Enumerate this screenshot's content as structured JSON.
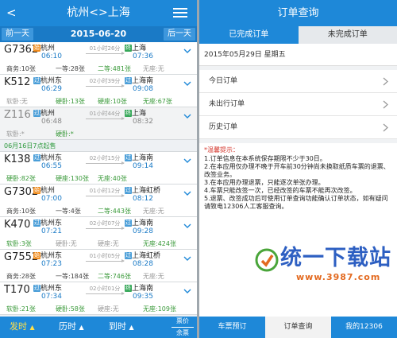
{
  "left": {
    "header": {
      "back": "<",
      "title": "杭州<>上海"
    },
    "datebar": {
      "prev": "前一天",
      "date": "2015-06-20",
      "next": "后一天"
    },
    "trains": [
      {
        "no": "G7362",
        "from_badge": "始",
        "from": "杭州",
        "dep": "06:10",
        "duration": "01小时26分",
        "to_badge": "终",
        "to": "上海",
        "arr": "07:36",
        "seats": [
          "商务:10张",
          "一等:28张",
          "二等:481张",
          "无座:无"
        ],
        "gray": false
      },
      {
        "no": "K512",
        "from_badge": "过",
        "from": "杭州东",
        "dep": "06:29",
        "duration": "02小时39分",
        "to_badge": "过",
        "to": "上海南",
        "arr": "09:08",
        "seats": [
          "软卧:无",
          "硬卧:13张",
          "硬座:10张",
          "无座:67张"
        ],
        "gray": false
      },
      {
        "no": "Z116",
        "from_badge": "过",
        "from": "杭州",
        "dep": "06:48",
        "duration": "01小时44分",
        "to_badge": "终",
        "to": "上海",
        "arr": "08:32",
        "seats": [
          "软卧:*",
          "硬卧:*"
        ],
        "gray": true
      },
      {
        "no": "K138",
        "from_badge": "过",
        "from": "杭州东",
        "dep": "06:55",
        "duration": "02小时15分",
        "to_badge": "过",
        "to": "上海南",
        "arr": "09:14",
        "seats": [
          "硬卧:82张",
          "硬座:130张",
          "无座:40张"
        ],
        "gray": false
      },
      {
        "no": "G7302",
        "from_badge": "始",
        "from": "杭州",
        "dep": "07:00",
        "duration": "01小时12分",
        "to_badge": "过",
        "to": "上海虹桥",
        "arr": "08:12",
        "seats": [
          "商务:10张",
          "一等:4张",
          "二等:443张",
          "无座:无"
        ],
        "gray": false
      },
      {
        "no": "K470",
        "from_badge": "过",
        "from": "杭州东",
        "dep": "07:21",
        "duration": "02小时07分",
        "to_badge": "过",
        "to": "上海南",
        "arr": "09:28",
        "seats": [
          "软卧:3张",
          "硬卧:无",
          "硬座:无",
          "无座:424张"
        ],
        "gray": false
      },
      {
        "no": "G7552",
        "from_badge": "始",
        "from": "杭州东",
        "dep": "07:23",
        "duration": "01小时05分",
        "to_badge": "过",
        "to": "上海虹桥",
        "arr": "08:28",
        "seats": [
          "商务:28张",
          "一等:184张",
          "二等:746张",
          "无座:无"
        ],
        "gray": false
      },
      {
        "no": "T170",
        "from_badge": "过",
        "from": "杭州东",
        "dep": "07:34",
        "duration": "02小时01分",
        "to_badge": "终",
        "to": "上海南",
        "arr": "09:35",
        "seats": [
          "软卧:21张",
          "硬卧:58张",
          "硬座:无",
          "无座:109张"
        ],
        "gray": false
      }
    ],
    "notice": "06月16日7点起售",
    "bottom": {
      "depart": "发时",
      "travel": "历时",
      "arrive": "到时",
      "price_top": "票价",
      "price_bottom": "余票"
    }
  },
  "right": {
    "title": "订单查询",
    "tabs": [
      "已完成订单",
      "未完成订单"
    ],
    "date": "2015年05月29日 星期五",
    "rows": [
      "今日订单",
      "未出行订单",
      "历史订单"
    ],
    "tip_title": "*温馨提示：",
    "tips": [
      "1.订单信息在本系统保存期限不少于30日。",
      "2.在本应用仅办理不晚于开车前30分钟尚未换取纸质车票的退票、改签业务。",
      "3.在本应用办理退票，只能逐次单张办理。",
      "4.车票只能改签一次，已经改签的车票不能再次改签。",
      "5.退票、改签成功后可使用订单查询功能确认订单状态，如有疑问请致电12306人工客服查询。"
    ],
    "watermark": {
      "text": "统一下载站",
      "url": "www.3987.com"
    },
    "bottom": [
      "车票预订",
      "订单查询",
      "我的12306"
    ]
  },
  "colors": {
    "primary": "#1e88d8",
    "accent": "#ffe04a",
    "seat_green": "#3a9a3a"
  }
}
